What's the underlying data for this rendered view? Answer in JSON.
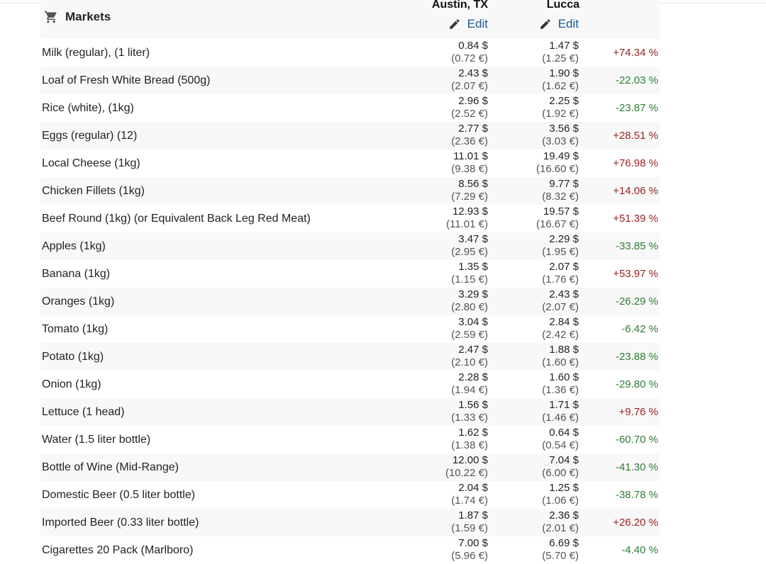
{
  "header": {
    "markets_label": "Markets",
    "cart_icon": "shopping-cart-icon",
    "city1": "Austin, TX",
    "city2": "Lucca",
    "edit_label": "Edit",
    "edit_icon": "pencil-icon"
  },
  "colors": {
    "positive": "#9b1e1e",
    "negative": "#2e7d32",
    "link": "#1a5a96",
    "alt_row": "#f8f8f8"
  },
  "rows": [
    {
      "item": "Milk (regular), (1 liter)",
      "austin_usd": "0.84 $",
      "austin_eur": "(0.72 €)",
      "lucca_usd": "1.47 $",
      "lucca_eur": "(1.25 €)",
      "diff": "+74.34 %"
    },
    {
      "item": "Loaf of Fresh White Bread (500g)",
      "austin_usd": "2.43 $",
      "austin_eur": "(2.07 €)",
      "lucca_usd": "1.90 $",
      "lucca_eur": "(1.62 €)",
      "diff": "-22.03 %"
    },
    {
      "item": "Rice (white), (1kg)",
      "austin_usd": "2.96 $",
      "austin_eur": "(2.52 €)",
      "lucca_usd": "2.25 $",
      "lucca_eur": "(1.92 €)",
      "diff": "-23.87 %"
    },
    {
      "item": "Eggs (regular) (12)",
      "austin_usd": "2.77 $",
      "austin_eur": "(2.36 €)",
      "lucca_usd": "3.56 $",
      "lucca_eur": "(3.03 €)",
      "diff": "+28.51 %"
    },
    {
      "item": "Local Cheese (1kg)",
      "austin_usd": "11.01 $",
      "austin_eur": "(9.38 €)",
      "lucca_usd": "19.49 $",
      "lucca_eur": "(16.60 €)",
      "diff": "+76.98 %"
    },
    {
      "item": "Chicken Fillets (1kg)",
      "austin_usd": "8.56 $",
      "austin_eur": "(7.29 €)",
      "lucca_usd": "9.77 $",
      "lucca_eur": "(8.32 €)",
      "diff": "+14.06 %"
    },
    {
      "item": "Beef Round (1kg) (or Equivalent Back Leg Red Meat)",
      "austin_usd": "12.93 $",
      "austin_eur": "(11.01 €)",
      "lucca_usd": "19.57 $",
      "lucca_eur": "(16.67 €)",
      "diff": "+51.39 %"
    },
    {
      "item": "Apples (1kg)",
      "austin_usd": "3.47 $",
      "austin_eur": "(2.95 €)",
      "lucca_usd": "2.29 $",
      "lucca_eur": "(1.95 €)",
      "diff": "-33.85 %"
    },
    {
      "item": "Banana (1kg)",
      "austin_usd": "1.35 $",
      "austin_eur": "(1.15 €)",
      "lucca_usd": "2.07 $",
      "lucca_eur": "(1.76 €)",
      "diff": "+53.97 %"
    },
    {
      "item": "Oranges (1kg)",
      "austin_usd": "3.29 $",
      "austin_eur": "(2.80 €)",
      "lucca_usd": "2.43 $",
      "lucca_eur": "(2.07 €)",
      "diff": "-26.29 %"
    },
    {
      "item": "Tomato (1kg)",
      "austin_usd": "3.04 $",
      "austin_eur": "(2.59 €)",
      "lucca_usd": "2.84 $",
      "lucca_eur": "(2.42 €)",
      "diff": "-6.42 %"
    },
    {
      "item": "Potato (1kg)",
      "austin_usd": "2.47 $",
      "austin_eur": "(2.10 €)",
      "lucca_usd": "1.88 $",
      "lucca_eur": "(1.60 €)",
      "diff": "-23.88 %"
    },
    {
      "item": "Onion (1kg)",
      "austin_usd": "2.28 $",
      "austin_eur": "(1.94 €)",
      "lucca_usd": "1.60 $",
      "lucca_eur": "(1.36 €)",
      "diff": "-29.80 %"
    },
    {
      "item": "Lettuce (1 head)",
      "austin_usd": "1.56 $",
      "austin_eur": "(1.33 €)",
      "lucca_usd": "1.71 $",
      "lucca_eur": "(1.46 €)",
      "diff": "+9.76 %"
    },
    {
      "item": "Water (1.5 liter bottle)",
      "austin_usd": "1.62 $",
      "austin_eur": "(1.38 €)",
      "lucca_usd": "0.64 $",
      "lucca_eur": "(0.54 €)",
      "diff": "-60.70 %"
    },
    {
      "item": "Bottle of Wine (Mid-Range)",
      "austin_usd": "12.00 $",
      "austin_eur": "(10.22 €)",
      "lucca_usd": "7.04 $",
      "lucca_eur": "(6.00 €)",
      "diff": "-41.30 %"
    },
    {
      "item": "Domestic Beer (0.5 liter bottle)",
      "austin_usd": "2.04 $",
      "austin_eur": "(1.74 €)",
      "lucca_usd": "1.25 $",
      "lucca_eur": "(1.06 €)",
      "diff": "-38.78 %"
    },
    {
      "item": "Imported Beer (0.33 liter bottle)",
      "austin_usd": "1.87 $",
      "austin_eur": "(1.59 €)",
      "lucca_usd": "2.36 $",
      "lucca_eur": "(2.01 €)",
      "diff": "+26.20 %"
    },
    {
      "item": "Cigarettes 20 Pack (Marlboro)",
      "austin_usd": "7.00 $",
      "austin_eur": "(5.96 €)",
      "lucca_usd": "6.69 $",
      "lucca_eur": "(5.70 €)",
      "diff": "-4.40 %"
    }
  ]
}
